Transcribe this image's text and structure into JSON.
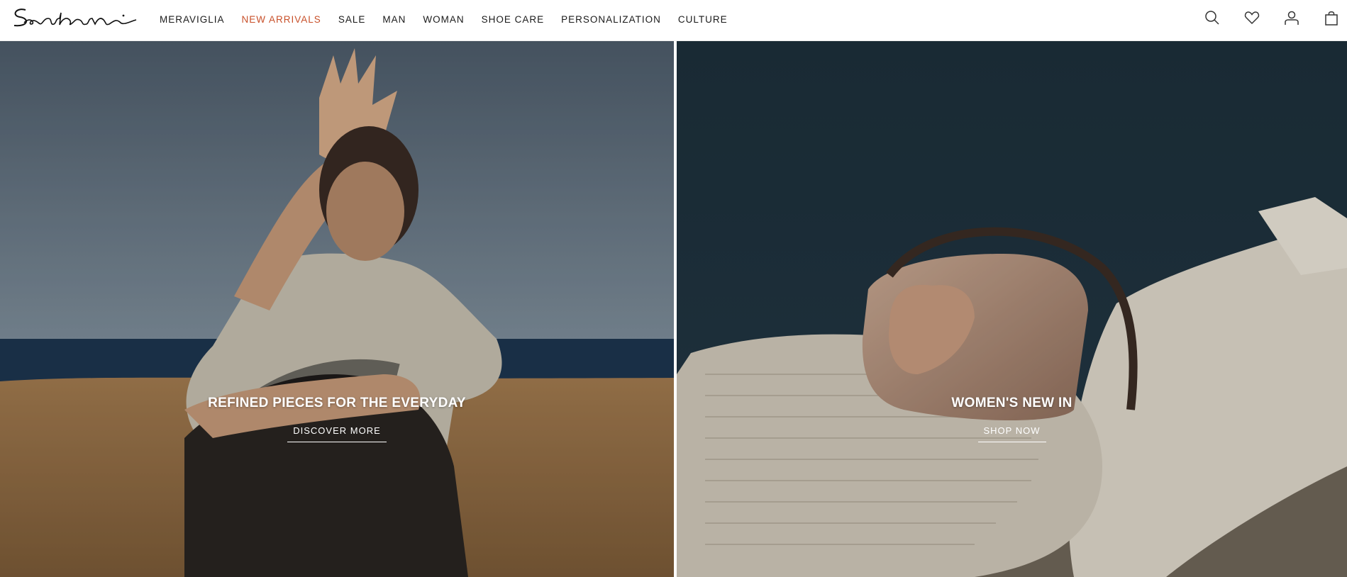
{
  "brand": {
    "name": "Santoni"
  },
  "nav": {
    "items": [
      {
        "label": "MERAVIGLIA"
      },
      {
        "label": "NEW ARRIVALS"
      },
      {
        "label": "SALE"
      },
      {
        "label": "MAN"
      },
      {
        "label": "WOMAN"
      },
      {
        "label": "SHOE CARE"
      },
      {
        "label": "PERSONALIZATION"
      },
      {
        "label": "CULTURE"
      }
    ],
    "accent_color": "#c8502a"
  },
  "header_icons": [
    "search-icon",
    "wishlist-heart-icon",
    "account-icon",
    "shopping-bag-icon"
  ],
  "hero": {
    "left": {
      "title": "REFINED PIECES FOR THE EVERYDAY",
      "cta": "DISCOVER MORE"
    },
    "right": {
      "title": "WOMEN'S NEW IN",
      "cta": "SHOP NOW"
    }
  }
}
